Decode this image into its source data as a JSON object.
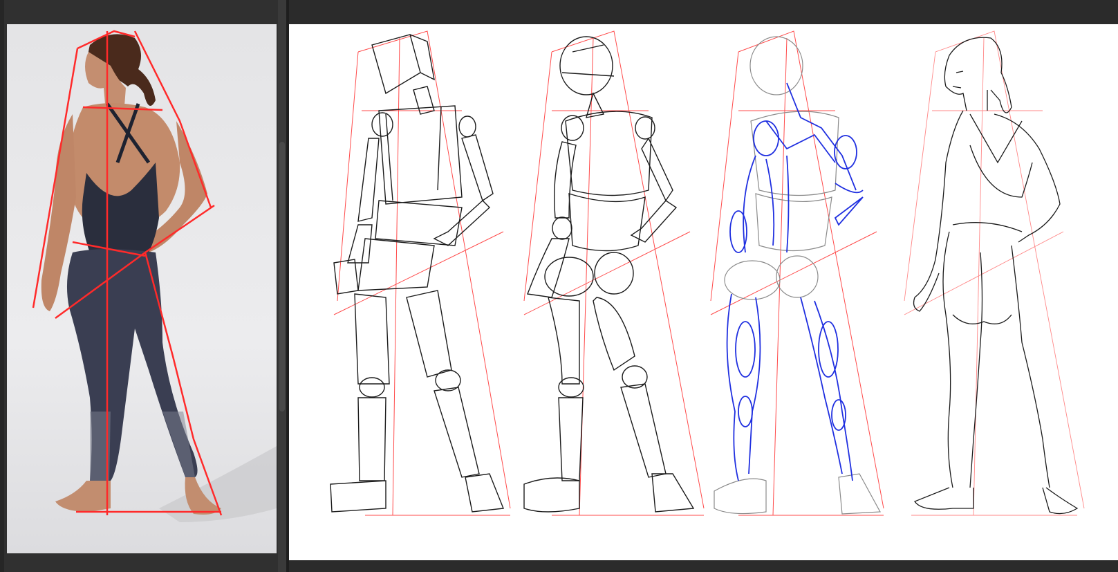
{
  "app": {
    "ui_colors": {
      "panel_bg": "#303030",
      "canvas_bg": "#ffffff",
      "guide_line": "#ff2a2a",
      "sketch_line": "#1a1a1a",
      "anatomy_line": "#1f2fe0"
    }
  },
  "reference": {
    "icon": "photo-reference"
  },
  "canvas": {
    "stages": [
      {
        "id": "stage-box-mannequin",
        "icon": "mannequin-box"
      },
      {
        "id": "stage-rounded-mannequin",
        "icon": "mannequin-round"
      },
      {
        "id": "stage-anatomy",
        "icon": "anatomy-overlay"
      },
      {
        "id": "stage-line-art",
        "icon": "line-art"
      }
    ]
  }
}
